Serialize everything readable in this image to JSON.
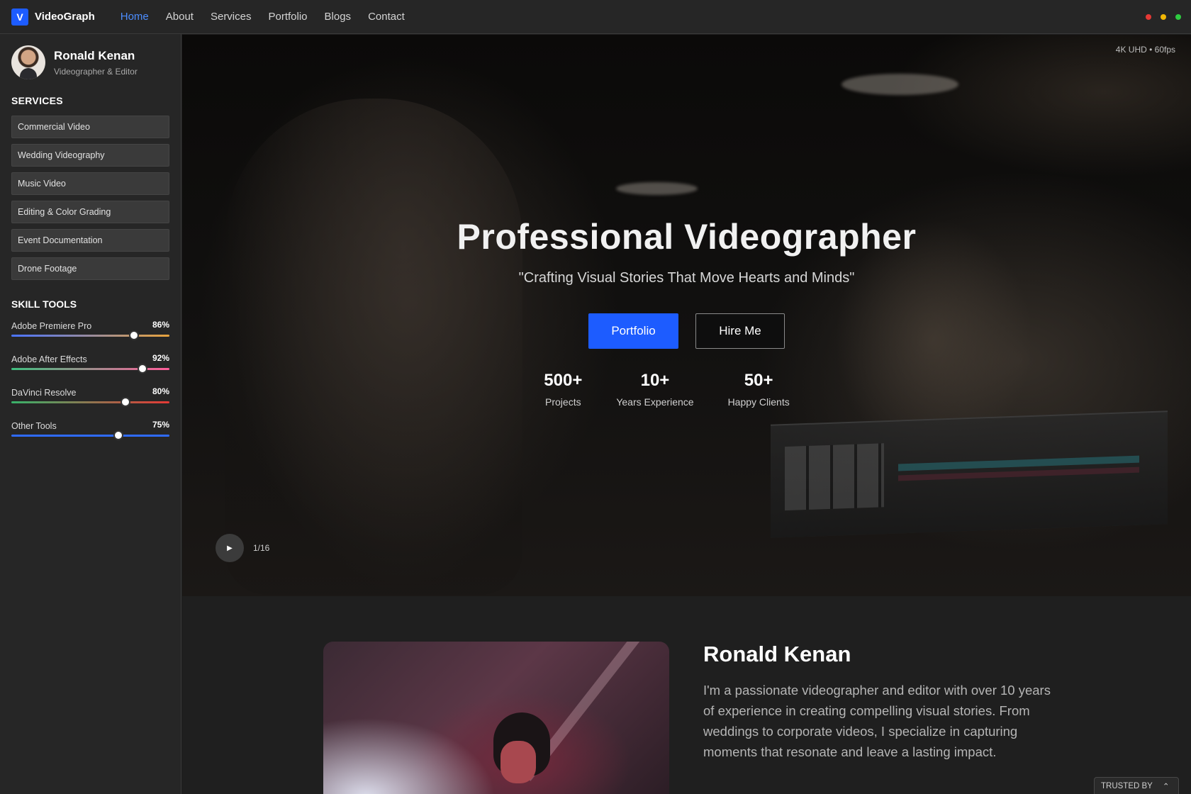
{
  "brand": {
    "logo_letter": "V",
    "name": "VideoGraph",
    "color": "#1d5cff"
  },
  "nav": [
    {
      "label": "Home",
      "active": true
    },
    {
      "label": "About"
    },
    {
      "label": "Services"
    },
    {
      "label": "Portfolio"
    },
    {
      "label": "Blogs"
    },
    {
      "label": "Contact"
    }
  ],
  "window_dots": [
    "#e53935",
    "#f2b705",
    "#2ecc40"
  ],
  "profile": {
    "name": "Ronald Kenan",
    "role": "Videographer & Editor"
  },
  "services": {
    "title": "SERVICES",
    "items": [
      "Commercial Video",
      "Wedding Videography",
      "Music Video",
      "Editing & Color Grading",
      "Event Documentation",
      "Drone Footage"
    ]
  },
  "skills": {
    "title": "SKILL TOOLS",
    "items": [
      {
        "name": "Adobe Premiere Pro",
        "label": "86%",
        "value": 0.86,
        "colors": [
          "#4a74ff",
          "#e8a33c"
        ]
      },
      {
        "name": "Adobe After Effects",
        "label": "92%",
        "value": 0.92,
        "colors": [
          "#3fbf7f",
          "#ff5c9a"
        ]
      },
      {
        "name": "DaVinci Resolve",
        "label": "80%",
        "value": 0.8,
        "colors": [
          "#38b26a",
          "#e53935"
        ]
      },
      {
        "name": "Other Tools",
        "label": "75%",
        "value": 0.75,
        "colors": [
          "#2f6bff",
          "#2f6bff"
        ]
      }
    ]
  },
  "hero": {
    "resolution": "4K UHD • 60fps",
    "title": "Professional Videographer",
    "subtitle": "\"Crafting Visual Stories That Move Hearts and Minds\"",
    "primary_button": "Portfolio",
    "secondary_button": "Hire Me",
    "stats": [
      {
        "value": "500+",
        "label": "Projects"
      },
      {
        "value": "10+",
        "label": "Years Experience"
      },
      {
        "value": "50+",
        "label": "Happy Clients"
      }
    ],
    "play_icon": "play-icon",
    "slide_counter": "1/16"
  },
  "about": {
    "name": "Ronald Kenan",
    "bio": "I'm a passionate videographer and editor with over 10 years of experience in creating compelling visual stories. From weddings to corporate videos, I specialize in capturing moments that resonate and leave a lasting impact."
  },
  "trusted": {
    "label": "TRUSTED BY",
    "icon": "chevron-up-icon"
  }
}
